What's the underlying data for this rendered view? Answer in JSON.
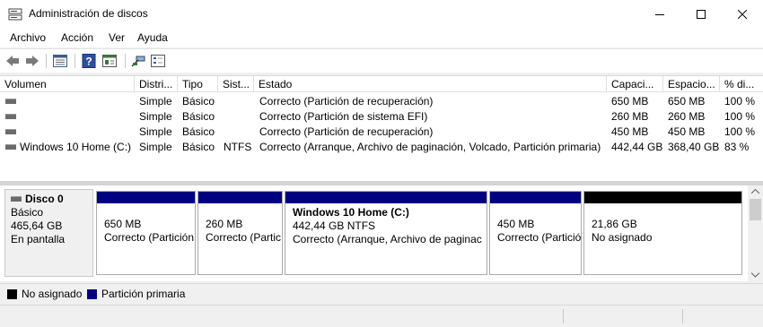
{
  "window": {
    "title": "Administración de discos"
  },
  "menu": [
    "Archivo",
    "Acción",
    "Ver",
    "Ayuda"
  ],
  "columns": [
    "Volumen",
    "Distri...",
    "Tipo",
    "Sist...",
    "Estado",
    "Capaci...",
    "Espacio...",
    "% di..."
  ],
  "volumes": [
    {
      "name": "",
      "layout": "Simple",
      "type": "Básico",
      "fs": "",
      "status": "Correcto (Partición de recuperación)",
      "capacity": "650 MB",
      "free": "650 MB",
      "pct": "100 %"
    },
    {
      "name": "",
      "layout": "Simple",
      "type": "Básico",
      "fs": "",
      "status": "Correcto (Partición de sistema EFI)",
      "capacity": "260 MB",
      "free": "260 MB",
      "pct": "100 %"
    },
    {
      "name": "",
      "layout": "Simple",
      "type": "Básico",
      "fs": "",
      "status": "Correcto (Partición de recuperación)",
      "capacity": "450 MB",
      "free": "450 MB",
      "pct": "100 %"
    },
    {
      "name": "Windows 10 Home (C:)",
      "layout": "Simple",
      "type": "Básico",
      "fs": "NTFS",
      "status": "Correcto (Arranque, Archivo de paginación, Volcado, Partición primaria)",
      "capacity": "442,44 GB",
      "free": "368,40 GB",
      "pct": "83 %"
    }
  ],
  "disk": {
    "name": "Disco 0",
    "type": "Básico",
    "size": "465,64 GB",
    "state": "En pantalla"
  },
  "partitions": [
    {
      "title": "",
      "size": "650 MB",
      "status": "Correcto (Partición",
      "kind": "primary"
    },
    {
      "title": "",
      "size": "260 MB",
      "status": "Correcto (Partic",
      "kind": "primary"
    },
    {
      "title": "Windows 10 Home (C:)",
      "size": "442,44 GB NTFS",
      "status": "Correcto (Arranque, Archivo de paginac",
      "kind": "primary"
    },
    {
      "title": "",
      "size": "450 MB",
      "status": "Correcto (Partició",
      "kind": "primary"
    },
    {
      "title": "",
      "size": "21,86 GB",
      "status": "No asignado",
      "kind": "unallocated"
    }
  ],
  "legend": {
    "unallocated": "No asignado",
    "primary": "Partición primaria"
  },
  "colors": {
    "primary": "#000080",
    "unallocated": "#000000"
  },
  "icons": [
    "app-disk-icon",
    "back-icon",
    "forward-icon",
    "volume-list-icon",
    "help-icon",
    "properties-icon",
    "connect-icon",
    "view-icon",
    "minimize-icon",
    "maximize-icon",
    "close-icon"
  ]
}
